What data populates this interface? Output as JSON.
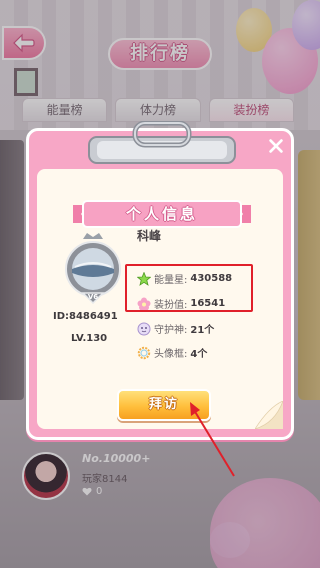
{
  "header": {
    "title": "排行榜",
    "back_icon": "back-arrow-icon"
  },
  "tabs": [
    {
      "label": "能量榜",
      "active": false
    },
    {
      "label": "体力榜",
      "active": false
    },
    {
      "label": "装扮榜",
      "active": true
    }
  ],
  "player_row": {
    "rank": "No.10000+",
    "name": "玩家8144",
    "likes": "0"
  },
  "modal": {
    "title": "个人信息",
    "close_icon": "close-icon",
    "user_name": "科峰",
    "vip_level": "V6",
    "id_text": "ID:8486491",
    "level_text": "LV.130",
    "stats": [
      {
        "label": "能量星:",
        "value": "430588",
        "icon": "star-icon"
      },
      {
        "label": "装扮值:",
        "value": "16541",
        "icon": "flower-icon"
      },
      {
        "label": "守护神:",
        "value": "21个",
        "icon": "guardian-icon"
      },
      {
        "label": "头像框:",
        "value": "4个",
        "icon": "wreath-icon"
      }
    ],
    "visit_label": "拜访"
  },
  "colors": {
    "accent_pink": "#f7a7c6",
    "highlight_red": "#e0202a",
    "button_orange": "#ffbf3c"
  }
}
